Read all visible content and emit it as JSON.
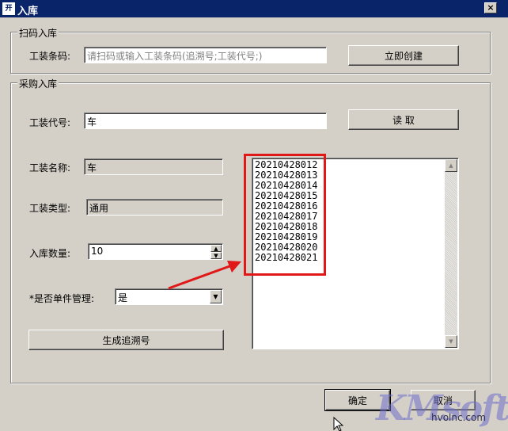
{
  "window": {
    "icon_text": "开",
    "title": "入库",
    "close_label": "×"
  },
  "scan_group": {
    "legend": "扫码入库",
    "barcode_label": "工装条码:",
    "barcode_placeholder": "请扫码或输入工装条码(追溯号;工装代号;)",
    "create_button": "立即创建"
  },
  "purchase_group": {
    "legend": "采购入库",
    "code_label": "工装代号:",
    "code_value": "车",
    "read_button": "读 取",
    "name_label": "工装名称:",
    "name_value": "车",
    "type_label": "工装类型:",
    "type_value": "通用",
    "qty_label": "入库数量:",
    "qty_value": "10",
    "single_label": "*是否单件管理:",
    "single_value": "是",
    "generate_button": "生成追溯号",
    "trace_numbers": [
      "20210428012",
      "20210428013",
      "20210428014",
      "20210428015",
      "20210428016",
      "20210428017",
      "20210428018",
      "20210428019",
      "20210428020",
      "20210428021"
    ]
  },
  "footer": {
    "ok_button": "确定",
    "cancel_button": "取消"
  },
  "watermark": {
    "mark": "KMsoft",
    "site": "hvolnc.com"
  },
  "colors": {
    "titlebar": "#0a246a",
    "annotation_red": "#e01818",
    "window_bg": "#d4d0c8"
  }
}
